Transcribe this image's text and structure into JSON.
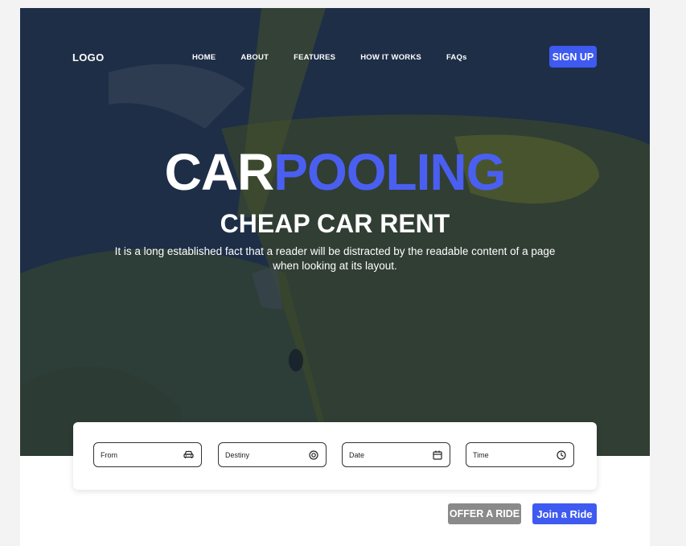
{
  "nav": {
    "logo": "LOGO",
    "links": [
      "HOME",
      "ABOUT",
      "FEATURES",
      "HOW IT WORKS",
      "FAQs"
    ],
    "signup_label": "SIGN UP"
  },
  "hero": {
    "title_part1": "CAR",
    "title_part2": "POOLING",
    "subtitle": "CHEAP CAR RENT",
    "description": "It is a long established fact that a reader will be distracted by the readable content of a page when looking at its layout."
  },
  "search": {
    "fields": [
      {
        "label": "From",
        "icon": "car-icon"
      },
      {
        "label": "Destiny",
        "icon": "target-icon"
      },
      {
        "label": "Date",
        "icon": "calendar-icon"
      },
      {
        "label": "Time",
        "icon": "clock-icon"
      }
    ]
  },
  "actions": {
    "offer_label": "OFFER A RIDE",
    "join_label": "Join a Ride"
  },
  "colors": {
    "accent": "#3f5af0",
    "hero_overlay": "#1e2e47",
    "offer_button": "#8a8a8a"
  }
}
